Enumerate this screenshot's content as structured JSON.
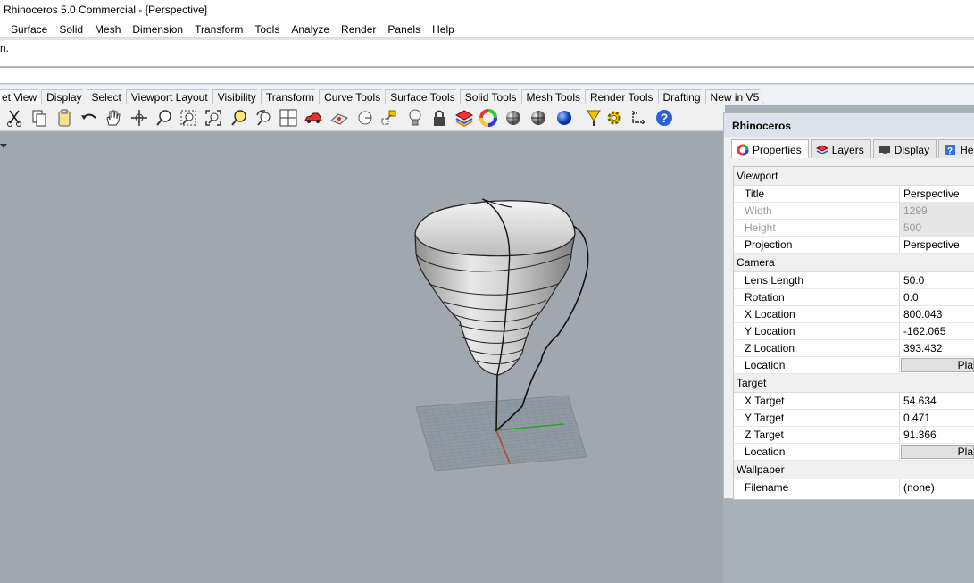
{
  "window": {
    "title": "Rhinoceros 5.0 Commercial - [Perspective]"
  },
  "menu": [
    "Surface",
    "Solid",
    "Mesh",
    "Dimension",
    "Transform",
    "Tools",
    "Analyze",
    "Render",
    "Panels",
    "Help"
  ],
  "command": {
    "history_tail": "n."
  },
  "toolbar_tabs": [
    "et View",
    "Display",
    "Select",
    "Viewport Layout",
    "Visibility",
    "Transform",
    "Curve Tools",
    "Surface Tools",
    "Solid Tools",
    "Mesh Tools",
    "Render Tools",
    "Drafting",
    "New in V5"
  ],
  "toolbar_icons": [
    "cut-icon",
    "copy-icon",
    "paste-icon",
    "undo-icon",
    "pan-hand-icon",
    "rotate-view-icon",
    "zoom-icon",
    "zoom-window-icon",
    "zoom-extents-icon",
    "zoom-selected-icon",
    "undo-view-icon",
    "four-viewports-icon",
    "car-camera-icon",
    "construction-plane-icon",
    "point-icon",
    "osnap-icon",
    "light-bulb-icon",
    "lock-icon",
    "layers-icon",
    "color-wheel-icon",
    "shaded-sphere-icon",
    "rendered-sphere-icon",
    "blue-sphere-icon",
    "gumball-icon",
    "settings-gear-icon",
    "dimension-icon",
    "help-icon"
  ],
  "panel": {
    "title": "Rhinoceros",
    "tabs": [
      {
        "label": "Properties",
        "icon": "properties-icon"
      },
      {
        "label": "Layers",
        "icon": "layers-icon"
      },
      {
        "label": "Display",
        "icon": "display-icon"
      },
      {
        "label": "Help",
        "icon": "help-icon"
      }
    ],
    "viewport": {
      "header": "Viewport",
      "title_k": "Title",
      "title_v": "Perspective",
      "width_k": "Width",
      "width_v": "1299",
      "height_k": "Height",
      "height_v": "500",
      "projection_k": "Projection",
      "projection_v": "Perspective"
    },
    "camera": {
      "header": "Camera",
      "lens_k": "Lens Length",
      "lens_v": "50.0",
      "rotation_k": "Rotation",
      "rotation_v": "0.0",
      "x_k": "X Location",
      "x_v": "800.043",
      "y_k": "Y Location",
      "y_v": "-162.065",
      "z_k": "Z Location",
      "z_v": "393.432",
      "location_k": "Location",
      "place_btn": "Pla"
    },
    "target": {
      "header": "Target",
      "x_k": "X Target",
      "x_v": "54.634",
      "y_k": "Y Target",
      "y_v": "0.471",
      "z_k": "Z Target",
      "z_v": "91.366",
      "location_k": "Location",
      "place_btn": "Pla"
    },
    "wallpaper": {
      "header": "Wallpaper",
      "filename_k": "Filename",
      "filename_v": "(none)"
    }
  }
}
